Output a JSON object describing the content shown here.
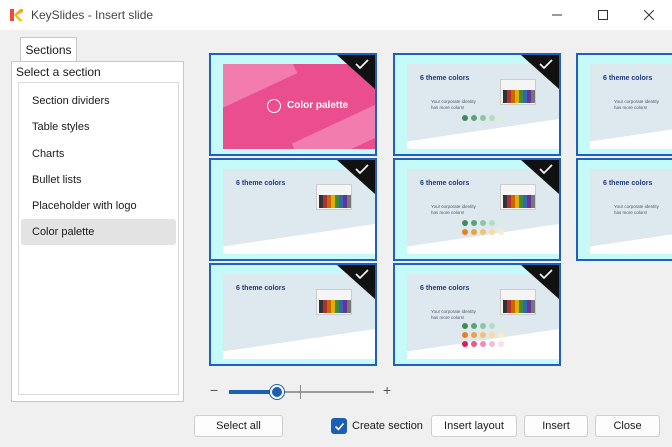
{
  "window": {
    "title": "KeySlides - Insert slide",
    "logo_icon": "keyslides-logo-icon"
  },
  "tabs": [
    {
      "label": "Sections"
    }
  ],
  "panel": {
    "label": "Select a section"
  },
  "sections": [
    {
      "label": "Section dividers",
      "selected": false
    },
    {
      "label": "Table styles",
      "selected": false
    },
    {
      "label": "Charts",
      "selected": false
    },
    {
      "label": "Bullet lists",
      "selected": false
    },
    {
      "label": "Placeholder with logo",
      "selected": false
    },
    {
      "label": "Color palette",
      "selected": true
    }
  ],
  "slides": [
    {
      "kind": "cover",
      "title": "Color palette",
      "checked": true
    },
    {
      "kind": "content",
      "title": "6 theme colors",
      "subtitle_line1": "Your corporate identity",
      "subtitle_line2": "has more colors!",
      "checked": true
    },
    {
      "kind": "content",
      "title": "6 theme colors",
      "subtitle_line1": "Your corporate identity",
      "subtitle_line2": "has more colors!",
      "checked": false
    },
    {
      "kind": "content",
      "title": "6 theme colors",
      "checked": true
    },
    {
      "kind": "content",
      "title": "6 theme colors",
      "subtitle_line1": "Your corporate identity",
      "subtitle_line2": "has more colors!",
      "checked": true
    },
    {
      "kind": "content",
      "title": "6 theme colors",
      "subtitle_line1": "Your corporate identity",
      "subtitle_line2": "has more colors!",
      "checked": false
    },
    {
      "kind": "content",
      "title": "6 theme colors",
      "checked": true
    },
    {
      "kind": "content",
      "title": "6 theme colors",
      "subtitle_line1": "Your corporate identity",
      "subtitle_line2": "has more colors!",
      "checked": true
    }
  ],
  "zoom": {
    "level_fraction": 0.33
  },
  "buttons": {
    "select_all": "Select all",
    "create_section": "Create section",
    "insert_layout": "Insert layout",
    "insert": "Insert",
    "close": "Close"
  },
  "create_section_checked": true,
  "colors": {
    "accent": "#1a5fb4",
    "thumb_bg": "#c6faf8",
    "thumb_border": "#1f5fbf",
    "cover_pink": "#ea4e8f",
    "title_blue": "#1f3a82"
  }
}
